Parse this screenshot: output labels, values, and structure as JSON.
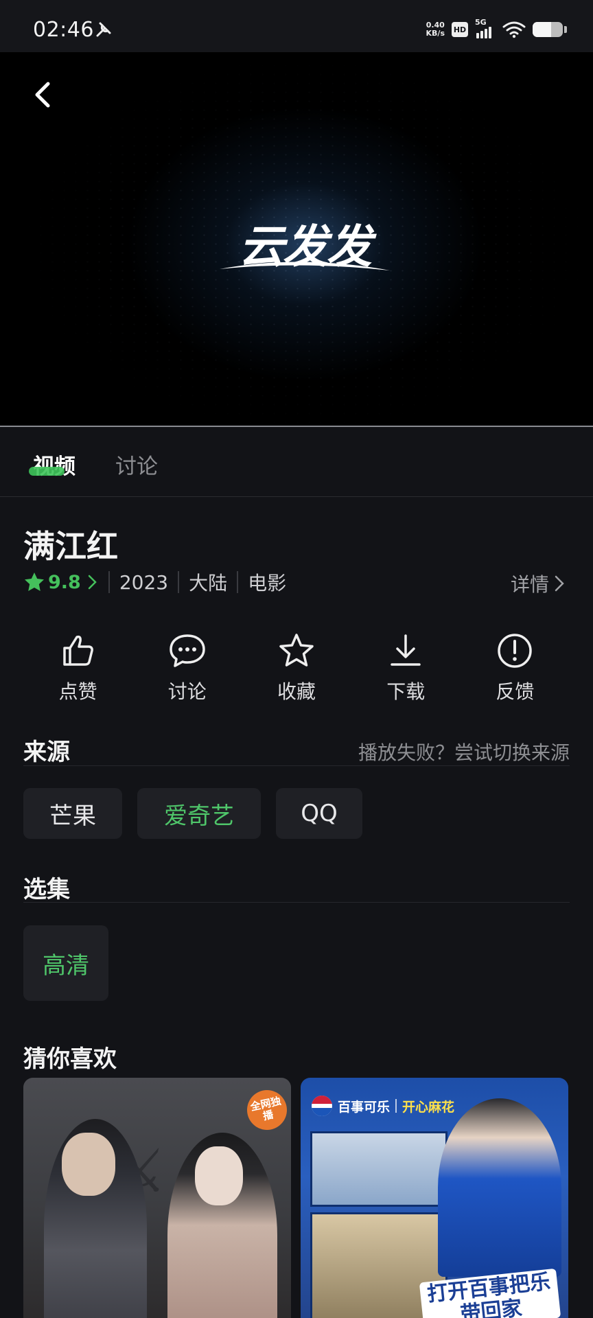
{
  "status_bar": {
    "time": "02:46",
    "net_speed_value": "0.40",
    "net_speed_unit": "KB/s",
    "hd_label": "HD",
    "network_label": "5G",
    "battery_level": 0.62
  },
  "video": {
    "logo_text": "云发发"
  },
  "tabs": [
    {
      "label": "视频",
      "active": true
    },
    {
      "label": "讨论",
      "active": false
    }
  ],
  "movie": {
    "title": "满江红",
    "rating": "9.8",
    "year": "2023",
    "region": "大陆",
    "category": "电影",
    "detail_label": "详情"
  },
  "actions": [
    {
      "label": "点赞",
      "icon": "thumbs-up-icon"
    },
    {
      "label": "讨论",
      "icon": "chat-bubble-icon"
    },
    {
      "label": "收藏",
      "icon": "star-outline-icon"
    },
    {
      "label": "下载",
      "icon": "download-icon"
    },
    {
      "label": "反馈",
      "icon": "alert-circle-icon"
    }
  ],
  "source": {
    "title": "来源",
    "hint": "播放失败？尝试切换来源",
    "options": [
      "芒果",
      "爱奇艺",
      "QQ"
    ],
    "selected": "爱奇艺"
  },
  "episodes": {
    "title": "选集",
    "items": [
      "高清"
    ]
  },
  "recommend": {
    "title": "猜你喜欢",
    "card1_badge": "全网独播",
    "card2_brand": "百事可乐",
    "card2_sub": "开心麻花",
    "card2_slogan": "打开百事把乐带回家"
  },
  "colors": {
    "accent_green": "#45c05c",
    "background": "#121317"
  }
}
